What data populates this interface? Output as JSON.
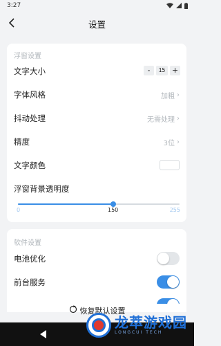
{
  "status": {
    "time": "3:27"
  },
  "header": {
    "title": "设置"
  },
  "section1": {
    "title": "浮窗设置",
    "font_size": {
      "label": "文字大小",
      "minus": "-",
      "value": "15",
      "plus": "+"
    },
    "font_style": {
      "label": "字体风格",
      "value": "加粗"
    },
    "jitter": {
      "label": "抖动处理",
      "value": "无需处理"
    },
    "precision": {
      "label": "精度",
      "value": "3位"
    },
    "text_color": {
      "label": "文字颜色",
      "color": "#ffffff"
    },
    "opacity": {
      "label": "浮窗背景透明度",
      "min": 0,
      "max": 255,
      "value": 150,
      "min_label": "0",
      "value_label": "150",
      "max_label": "255"
    }
  },
  "section2": {
    "title": "软件设置",
    "battery": {
      "label": "电池优化",
      "on": false
    },
    "foreground": {
      "label": "前台服务",
      "on": true
    }
  },
  "footer": {
    "reset_label": "恢复默认设置"
  },
  "watermark": {
    "main": "龙萃游戏园",
    "sub": "LONGCUI TECH"
  },
  "colors": {
    "accent": "#3a8ee6",
    "bg": "#f2f3f5",
    "muted": "#b3b8bd"
  }
}
